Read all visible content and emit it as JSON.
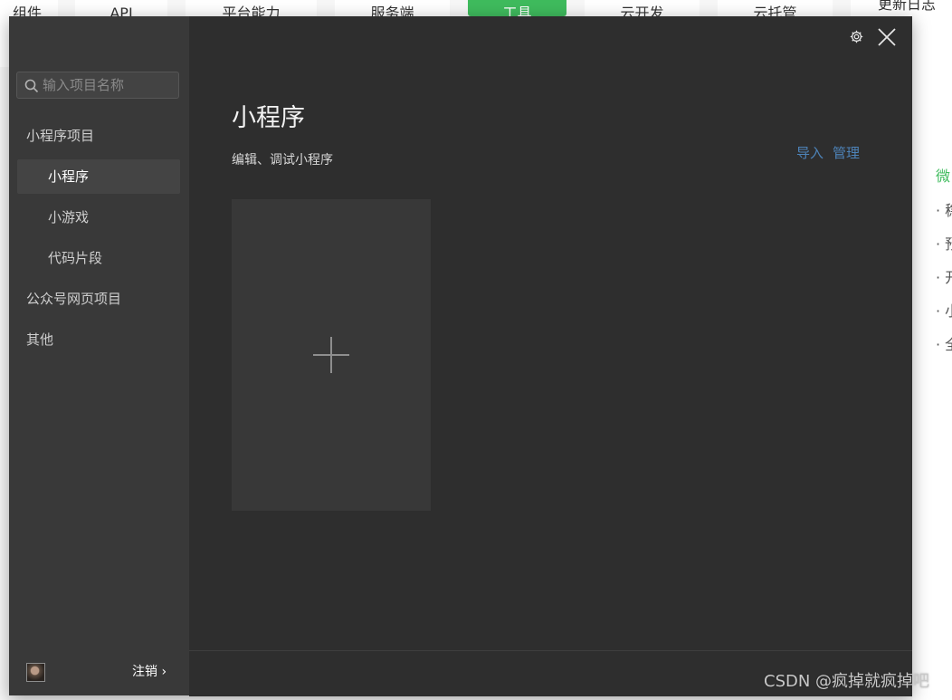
{
  "background": {
    "nav_tabs": [
      {
        "label": "组件",
        "active": false
      },
      {
        "label": "API",
        "active": false
      },
      {
        "label": "平台能力",
        "active": false
      },
      {
        "label": "服务端",
        "active": false
      },
      {
        "label": "工具",
        "active": true
      },
      {
        "label": "云开发",
        "active": false
      },
      {
        "label": "云托管",
        "active": false
      },
      {
        "label": "更新日志",
        "active": false
      }
    ],
    "side_title": "微",
    "side_items": [
      "· 稳",
      "· 预",
      "· 开",
      "· 小",
      "· 全"
    ]
  },
  "modal": {
    "search": {
      "placeholder": "输入项目名称",
      "value": ""
    },
    "sidebar": {
      "items": [
        {
          "label": "小程序项目",
          "kind": "group",
          "selected": false
        },
        {
          "label": "小程序",
          "kind": "sub",
          "selected": true
        },
        {
          "label": "小游戏",
          "kind": "sub",
          "selected": false
        },
        {
          "label": "代码片段",
          "kind": "sub",
          "selected": false
        },
        {
          "label": "公众号网页项目",
          "kind": "group",
          "selected": false
        },
        {
          "label": "其他",
          "kind": "group",
          "selected": false
        }
      ],
      "footer": {
        "logout_label": "注销 ›"
      }
    },
    "header_icons": [
      "gear-icon",
      "close-icon"
    ],
    "main": {
      "title": "小程序",
      "subtitle": "编辑、调试小程序",
      "actions": {
        "import": "导入",
        "manage": "管理"
      },
      "add_card_icon": "plus-icon"
    }
  },
  "watermark": "CSDN @疯掉就疯掉吧",
  "colors": {
    "accent_green": "#3fbb5d",
    "modal_bg": "#2e2e2e",
    "sidebar_bg": "#393939",
    "link_blue": "#4d83b8"
  }
}
